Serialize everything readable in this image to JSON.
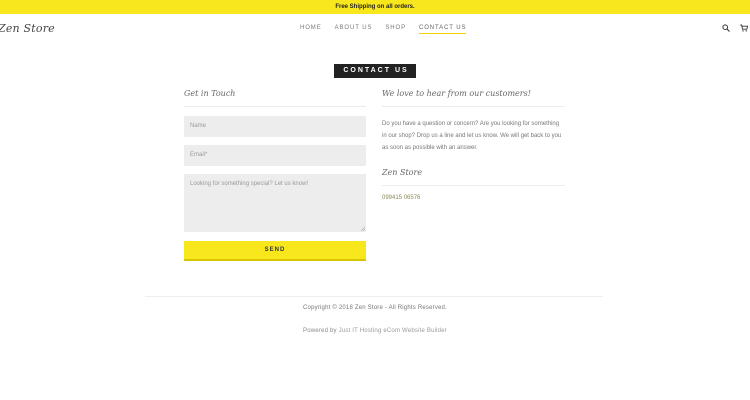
{
  "announcement": "Free Shipping on all orders.",
  "header": {
    "logo": "Zen Store",
    "nav": [
      "HOME",
      "ABOUT US",
      "SHOP",
      "CONTACT US"
    ],
    "active_nav": "CONTACT US",
    "icons": [
      "search-icon",
      "cart-icon"
    ]
  },
  "page": {
    "title": "CONTACT US"
  },
  "form": {
    "heading": "Get in Touch",
    "name_placeholder": "Name",
    "email_placeholder": "Email*",
    "message_placeholder": "Looking for something special? Let us know!",
    "send_label": "SEND"
  },
  "info": {
    "heading": "We love to hear from our customers!",
    "text": "Do you have a question or concern? Are you looking for something in our shop? Drop us a line and let us know. We will get back to you as soon as possible with an answer.",
    "store_name": "Zen Store",
    "phone": "099415 06576"
  },
  "footer": {
    "copyright": "Copyright © 2018 Zen Store - All Rights Reserved.",
    "powered_prefix": "Powered by",
    "powered_link": "Just IT Hosting eCom Website Builder"
  },
  "colors": {
    "accent": "#f8e71c",
    "dark": "#222222"
  }
}
